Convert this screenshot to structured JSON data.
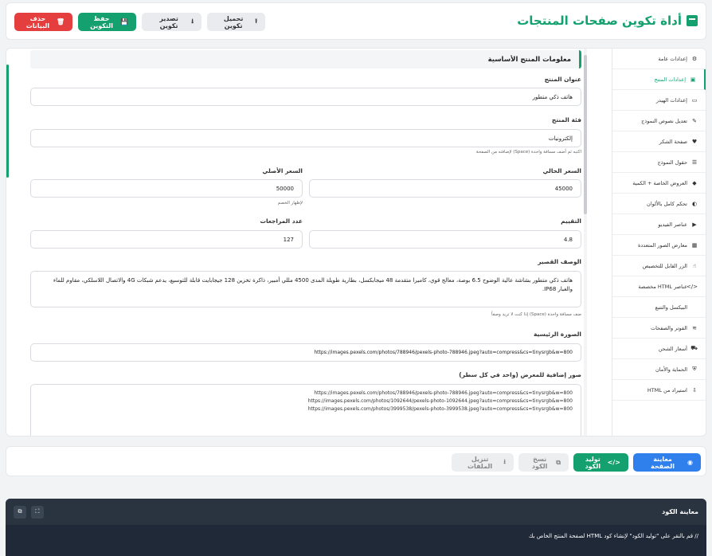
{
  "header": {
    "title": "أداة تكوين صفحات المنتجات",
    "actions": {
      "load": "تحميل تكوين",
      "export": "تصدير تكوين",
      "save": "حفظ التكوين",
      "clear": "حذف البيانات"
    }
  },
  "sidebar": {
    "items": [
      {
        "label": "إعدادات عامة",
        "icon": "gear-icon"
      },
      {
        "label": "إعدادات المنتج",
        "icon": "box-icon"
      },
      {
        "label": "إعدادات الهيدر",
        "icon": "header-icon"
      },
      {
        "label": "تعديل نصوص النموذج",
        "icon": "edit-icon"
      },
      {
        "label": "صفحة الشكر",
        "icon": "heart-icon"
      },
      {
        "label": "حقول النموذج",
        "icon": "list-icon"
      },
      {
        "label": "العروض الخاصة + الكمية",
        "icon": "tag-icon"
      },
      {
        "label": "تحكم كامل بالألوان",
        "icon": "palette-icon"
      },
      {
        "label": "عناصر الفيديو",
        "icon": "play-icon"
      },
      {
        "label": "معارض الصور المتعددة",
        "icon": "images-icon"
      },
      {
        "label": "الزر القابل للتخصيص",
        "icon": "pointer-icon"
      },
      {
        "label": "عناصر HTML مخصصة",
        "icon": "code-icon"
      },
      {
        "label": "البيكسل والتتبع",
        "icon": "chart-icon"
      },
      {
        "label": "الفوتر والصفحات",
        "icon": "layers-icon"
      },
      {
        "label": "أسعار الشحن",
        "icon": "truck-icon"
      },
      {
        "label": "الحماية والأمان",
        "icon": "shield-icon"
      },
      {
        "label": "استيراد من HTML",
        "icon": "import-icon"
      }
    ]
  },
  "section": {
    "title": "معلومات المنتج الأساسية"
  },
  "form": {
    "product_title": {
      "label": "عنوان المنتج",
      "value": "هاتف ذكي متطور"
    },
    "category": {
      "label": "فئة المنتج",
      "value": "إلكترونيات",
      "hint": "اكتبه ثم أضف مسافة واحدة (Space) لإضافته من الصفحة"
    },
    "current_price": {
      "label": "السعر الحالي",
      "value": "45000"
    },
    "original_price": {
      "label": "السعر الأصلي",
      "value": "50000",
      "hint": "لإظهار الخصم"
    },
    "rating": {
      "label": "التقييم",
      "value": "4.8"
    },
    "reviews": {
      "label": "عدد المراجعات",
      "value": "127"
    },
    "short_desc": {
      "label": "الوصف القصير",
      "value": "هاتف ذكي متطور بشاشة عالية الوضوح 6.5 بوصة، معالج قوي، كاميرا متقدمة 48 ميجابكسل، بطارية طويلة المدى 4500 مللي أمبير، ذاكرة تخزين 128 جيجابايت قابلة للتوسيع، يدعم شبكات 4G والاتصال اللاسلكي، مقاوم للماء والغبار IP68.",
      "hint": "ضف مسافة واحدة (Space) إذا كنت لا تريد وصفاً"
    },
    "main_image": {
      "label": "الصورة الرئيسية",
      "value": "https://images.pexels.com/photos/788946/pexels-photo-788946.jpeg?auto=compress&cs=tinysrgb&w=800"
    },
    "gallery": {
      "label": "صور إضافية للمعرض (واحد في كل سطر)",
      "lines": [
        "https://images.pexels.com/photos/788946/pexels-photo-788946.jpeg?auto=compress&cs=tinysrgb&w=800",
        "https://images.pexels.com/photos/1092644/pexels-photo-1092644.jpeg?auto=compress&cs=tinysrgb&w=800",
        "https://images.pexels.com/photos/3999538/pexels-photo-3999538.jpeg?auto=compress&cs=tinysrgb&w=800"
      ]
    }
  },
  "actionbar": {
    "preview": "معاينة الصفحة",
    "generate": "توليد الكود",
    "copy": "نسخ الكود",
    "download": "تنزيل الملفات"
  },
  "code": {
    "title": "معاينة الكود",
    "placeholder": "// قم بالنقر على \"توليد الكود\" لإنشاء كود HTML لصفحة المنتج الخاص بك"
  }
}
